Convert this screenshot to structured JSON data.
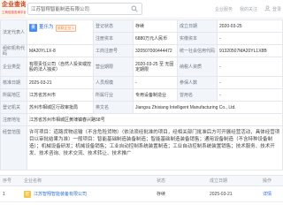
{
  "header": {
    "logo_title": "企业查询",
    "logo_subtitle": "工商信息查询平台",
    "search": {
      "value": "江苏智翔智能制造有限公司",
      "icon": "search-icon"
    },
    "nav": [
      "企业服务",
      "我的关注",
      "登录"
    ],
    "user_icon": "user-icon"
  },
  "info": {
    "legal_rep": {
      "label": "法定代表人",
      "avatar": "董",
      "name": "董乐为",
      "tag": "关联企业 1"
    },
    "status": {
      "label": "登记状态",
      "value": "存续"
    },
    "established": {
      "label": "成立日期",
      "value": "2020-03-25"
    },
    "registered_capital": {
      "label": "注册资本",
      "value": "6880万元人民币"
    },
    "paid_in_capital": {
      "label": "实缴资本",
      "value": "-"
    },
    "org_code": {
      "label": "组织机构代码",
      "value": "MA20YL1X-8"
    },
    "reg_no": {
      "label": "工商注册号",
      "value": "320507000444472"
    },
    "credit_code": {
      "label": "统一社会信用代码",
      "value": "91320507MA20YL1X8B"
    },
    "company_type": {
      "label": "企业类型",
      "value": "有限责任公司（自然人投资或控股的法人独资）"
    },
    "business_term": {
      "label": "营业期限",
      "value": "2020-03-25 至 无固定期限"
    },
    "taxpayer_qualification": {
      "label": "纳税人资质",
      "value": "-"
    },
    "approval_date": {
      "label": "核准日期",
      "value": "2025-03-21"
    },
    "staff_size": {
      "label": "人员规模",
      "value": "-"
    },
    "insured_count": {
      "label": "参保人数",
      "value": "-"
    },
    "region": {
      "label": "所属地区",
      "value": "江苏省苏州市"
    },
    "industry": {
      "label": "所属行业",
      "value": "专用设备制造业"
    },
    "former_name": {
      "label": "曾用名",
      "value": "-"
    },
    "authority": {
      "label": "登记机关",
      "value": "苏州市相城区行政审批局"
    },
    "english_name": {
      "label": "英文名",
      "value": "Jiangsu Zhixiang Intelligent Manufacturing Co., Ltd."
    },
    "address": {
      "label": "注册地址",
      "value": "江苏省苏州市相城区黄埭镇春兴路58号"
    },
    "business_scope": {
      "label": "经营范围",
      "value": "许可项目：道路货物运输（不含危险货物）（依法须经批准的项目，经相关部门批准后方可开展经营活动，具体经营项目以审批结果为准）一般项目：智能基础制造装备制造；智能基础制造装备销售；通用设备制造（不含特种设备制造）；机械设备研发；机械设备销售；工业自动控制系统装置制造；工业自动控制系统装置销售；技术服务、技术开发、技术咨询、技术交流、技术转让、技术推广"
    }
  },
  "related_list": {
    "columns": [
      "序号",
      "企业名称",
      "状态",
      "成立日期",
      "操作"
    ],
    "rows": [
      {
        "index": "1",
        "logo": "智",
        "name": "江苏智翔智能装备有限公司",
        "status": "存续",
        "date": "2025-03-21",
        "action": "详情"
      }
    ]
  },
  "colors": {
    "label_bg": "#f2f6fb",
    "link": "#2f6fd6",
    "tag": "#ff7a33",
    "border": "#e4e8ee",
    "logo": "#c8431a"
  }
}
